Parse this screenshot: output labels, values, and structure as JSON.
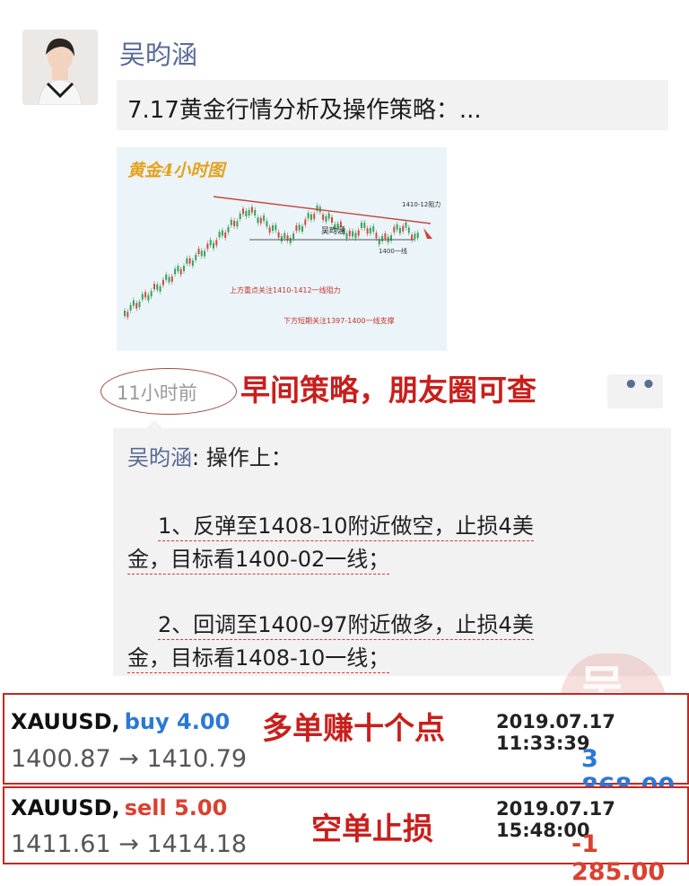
{
  "post": {
    "username": "吴昀涵",
    "title": "7.17黄金行情分析及操作策略：...",
    "time": "11小时前",
    "annotation": "早间策略，朋友圈可查",
    "more_dots": "••"
  },
  "chart_image": {
    "title": "黄金4小时图",
    "label_resistance": "1410-12阻力",
    "label_support_line": "1400一线",
    "label_watermark": "吴昀涵",
    "note_upper": "上方重点关注1410-1412一线阻力",
    "note_lower": "下方短期关注1397-1400一线支撑"
  },
  "comment": {
    "author": "吴昀涵",
    "intro": ": 操作上：",
    "item1_line1": "1、反弹至1408-10附近做空，止损4美",
    "item1_line2": "金，目标看1400-02一线；",
    "item2_line1": "2、回调至1400-97附近做多，止损4美",
    "item2_line2": "金，目标看1408-10一线；"
  },
  "stamp": {
    "text": "吴"
  },
  "trades": [
    {
      "symbol": "XAUUSD,",
      "side": "buy 4.00",
      "datetime": "2019.07.17 11:33:39",
      "prices": "1400.87 → 1410.79",
      "profit": "3 868.00",
      "annotation": "多单赚十个点"
    },
    {
      "symbol": "XAUUSD,",
      "side": "sell 5.00",
      "datetime": "2019.07.17 15:48:00",
      "prices": "1411.61 → 1414.18",
      "profit": "-1 285.00",
      "annotation": "空单止损"
    }
  ],
  "colors": {
    "link_name": "#5a6c95",
    "annotation_red": "#c81f1c",
    "buy_blue": "#2b78d6",
    "sell_red": "#d9412f"
  }
}
